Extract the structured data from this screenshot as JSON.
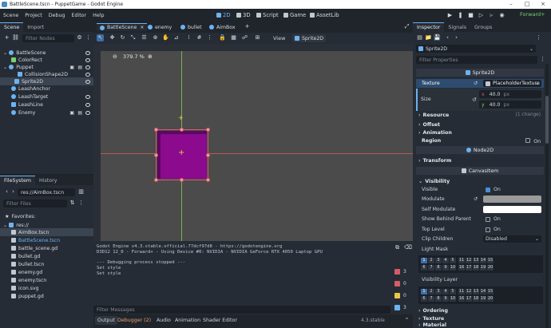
{
  "window": {
    "title": "BattleScene.tscn - PuppetGame - Godot Engine"
  },
  "menu": [
    "Scene",
    "Project",
    "Debug",
    "Editor",
    "Help"
  ],
  "workspaces": [
    {
      "label": "2D",
      "active": true
    },
    {
      "label": "3D",
      "active": false
    },
    {
      "label": "Script",
      "active": false
    },
    {
      "label": "Game",
      "active": false
    },
    {
      "label": "AssetLib",
      "active": false
    }
  ],
  "renderer": "Forward+",
  "scene_dock": {
    "tabs": [
      "Scene",
      "Import"
    ],
    "filter_placeholder": "Filter Nodes",
    "nodes": [
      {
        "label": "BattleScene",
        "icon": "node2d-icon"
      },
      {
        "label": "ColorRect",
        "icon": "control-icon"
      },
      {
        "label": "Puppet",
        "icon": "node2d-icon"
      },
      {
        "label": "CollisionShape2D",
        "icon": "collision-icon"
      },
      {
        "label": "Sprite2D",
        "icon": "sprite-icon"
      },
      {
        "label": "LeashAnchor",
        "icon": "marker-icon"
      },
      {
        "label": "LeashTarget",
        "icon": "marker-icon"
      },
      {
        "label": "LeashLine",
        "icon": "line-icon"
      },
      {
        "label": "Enemy",
        "icon": "node2d-icon"
      }
    ]
  },
  "filesystem": {
    "tabs": [
      "FileSystem",
      "History"
    ],
    "path": "res://AimBox.tscn",
    "filter_placeholder": "Filter Files",
    "favorites_label": "Favorites:",
    "root": "res://",
    "files": [
      "AimBox.tscn",
      "BattleScene.tscn",
      "battle_scene.gd",
      "bullet.gd",
      "bullet.tscn",
      "enemy.gd",
      "enemy.tscn",
      "icon.svg",
      "puppet.gd"
    ]
  },
  "editor_tabs": [
    "BattleScene",
    "enemy",
    "bullet",
    "AimBox"
  ],
  "viewport": {
    "zoom": "379.7 %",
    "view_label": "View",
    "selected_node": "Sprite2D",
    "sprite_color": "#8b0a8e"
  },
  "output": {
    "lines": [
      "Godot Engine v4.3.stable.official.77dcf97d8 - https://godotengine.org",
      "D3D12 12_0 - Forward+ - Using Device #0: NVIDIA - NVIDIA GeForce RTX 4050 Laptop GPU",
      "",
      "--- Debugging process stopped ---",
      "Set style",
      "Set style"
    ],
    "filter_placeholder": "Filter Messages",
    "counters": [
      "3",
      "0",
      "0",
      "3"
    ]
  },
  "bottom_tabs": [
    "Output",
    "Debugger (2)",
    "Audio",
    "Animation",
    "Shader Editor"
  ],
  "version": "4.3.stable",
  "inspector": {
    "tabs": [
      "Inspector",
      "Signals",
      "Groups"
    ],
    "node": "Sprite2D",
    "filter_placeholder": "Filter Properties",
    "class_header": "Sprite2D",
    "texture_label": "Texture",
    "texture_value": "PlaceholderTexture",
    "size_label": "Size",
    "size_x_label": "x",
    "size_x": "40.0",
    "size_y_label": "y",
    "size_y": "40.0",
    "unit": "px",
    "resource_label": "Resource",
    "resource_changes": "(1 change)",
    "offset_label": "Offset",
    "animation_label": "Animation",
    "region_label": "Region",
    "region_value": "On",
    "node2d_header": "Node2D",
    "transform_label": "Transform",
    "canvasitem_header": "CanvasItem",
    "visibility_label": "Visibility",
    "visible_label": "Visible",
    "visible_value": "On",
    "modulate_label": "Modulate",
    "self_modulate_label": "Self Modulate",
    "show_behind_label": "Show Behind Parent",
    "show_behind_value": "On",
    "top_level_label": "Top Level",
    "top_level_value": "On",
    "clip_children_label": "Clip Children",
    "clip_children_value": "Disabled",
    "light_mask_label": "Light Mask",
    "visibility_layer_label": "Visibility Layer",
    "layers_row1": [
      "1",
      "2",
      "3",
      "4",
      "5",
      "11",
      "12",
      "13",
      "14",
      "15"
    ],
    "layers_row2": [
      "6",
      "7",
      "8",
      "9",
      "10",
      "16",
      "17",
      "18",
      "19",
      "20"
    ],
    "ordering_label": "Ordering",
    "texture2_label": "Texture",
    "material_label": "Material"
  }
}
